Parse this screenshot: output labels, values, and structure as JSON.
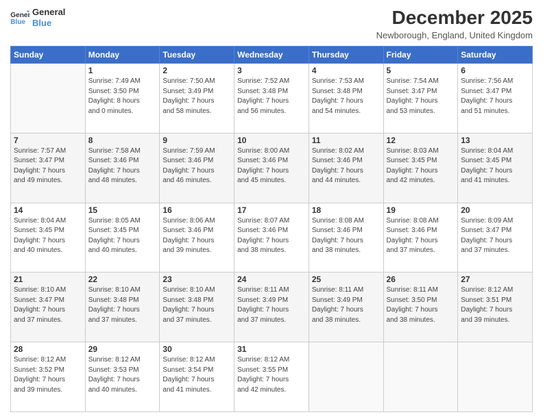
{
  "header": {
    "logo_line1": "General",
    "logo_line2": "Blue",
    "month_year": "December 2025",
    "location": "Newborough, England, United Kingdom"
  },
  "days_of_week": [
    "Sunday",
    "Monday",
    "Tuesday",
    "Wednesday",
    "Thursday",
    "Friday",
    "Saturday"
  ],
  "weeks": [
    [
      {
        "day": "",
        "content": ""
      },
      {
        "day": "1",
        "content": "Sunrise: 7:49 AM\nSunset: 3:50 PM\nDaylight: 8 hours\nand 0 minutes."
      },
      {
        "day": "2",
        "content": "Sunrise: 7:50 AM\nSunset: 3:49 PM\nDaylight: 7 hours\nand 58 minutes."
      },
      {
        "day": "3",
        "content": "Sunrise: 7:52 AM\nSunset: 3:48 PM\nDaylight: 7 hours\nand 56 minutes."
      },
      {
        "day": "4",
        "content": "Sunrise: 7:53 AM\nSunset: 3:48 PM\nDaylight: 7 hours\nand 54 minutes."
      },
      {
        "day": "5",
        "content": "Sunrise: 7:54 AM\nSunset: 3:47 PM\nDaylight: 7 hours\nand 53 minutes."
      },
      {
        "day": "6",
        "content": "Sunrise: 7:56 AM\nSunset: 3:47 PM\nDaylight: 7 hours\nand 51 minutes."
      }
    ],
    [
      {
        "day": "7",
        "content": "Sunrise: 7:57 AM\nSunset: 3:47 PM\nDaylight: 7 hours\nand 49 minutes."
      },
      {
        "day": "8",
        "content": "Sunrise: 7:58 AM\nSunset: 3:46 PM\nDaylight: 7 hours\nand 48 minutes."
      },
      {
        "day": "9",
        "content": "Sunrise: 7:59 AM\nSunset: 3:46 PM\nDaylight: 7 hours\nand 46 minutes."
      },
      {
        "day": "10",
        "content": "Sunrise: 8:00 AM\nSunset: 3:46 PM\nDaylight: 7 hours\nand 45 minutes."
      },
      {
        "day": "11",
        "content": "Sunrise: 8:02 AM\nSunset: 3:46 PM\nDaylight: 7 hours\nand 44 minutes."
      },
      {
        "day": "12",
        "content": "Sunrise: 8:03 AM\nSunset: 3:45 PM\nDaylight: 7 hours\nand 42 minutes."
      },
      {
        "day": "13",
        "content": "Sunrise: 8:04 AM\nSunset: 3:45 PM\nDaylight: 7 hours\nand 41 minutes."
      }
    ],
    [
      {
        "day": "14",
        "content": "Sunrise: 8:04 AM\nSunset: 3:45 PM\nDaylight: 7 hours\nand 40 minutes."
      },
      {
        "day": "15",
        "content": "Sunrise: 8:05 AM\nSunset: 3:45 PM\nDaylight: 7 hours\nand 40 minutes."
      },
      {
        "day": "16",
        "content": "Sunrise: 8:06 AM\nSunset: 3:46 PM\nDaylight: 7 hours\nand 39 minutes."
      },
      {
        "day": "17",
        "content": "Sunrise: 8:07 AM\nSunset: 3:46 PM\nDaylight: 7 hours\nand 38 minutes."
      },
      {
        "day": "18",
        "content": "Sunrise: 8:08 AM\nSunset: 3:46 PM\nDaylight: 7 hours\nand 38 minutes."
      },
      {
        "day": "19",
        "content": "Sunrise: 8:08 AM\nSunset: 3:46 PM\nDaylight: 7 hours\nand 37 minutes."
      },
      {
        "day": "20",
        "content": "Sunrise: 8:09 AM\nSunset: 3:47 PM\nDaylight: 7 hours\nand 37 minutes."
      }
    ],
    [
      {
        "day": "21",
        "content": "Sunrise: 8:10 AM\nSunset: 3:47 PM\nDaylight: 7 hours\nand 37 minutes."
      },
      {
        "day": "22",
        "content": "Sunrise: 8:10 AM\nSunset: 3:48 PM\nDaylight: 7 hours\nand 37 minutes."
      },
      {
        "day": "23",
        "content": "Sunrise: 8:10 AM\nSunset: 3:48 PM\nDaylight: 7 hours\nand 37 minutes."
      },
      {
        "day": "24",
        "content": "Sunrise: 8:11 AM\nSunset: 3:49 PM\nDaylight: 7 hours\nand 37 minutes."
      },
      {
        "day": "25",
        "content": "Sunrise: 8:11 AM\nSunset: 3:49 PM\nDaylight: 7 hours\nand 38 minutes."
      },
      {
        "day": "26",
        "content": "Sunrise: 8:11 AM\nSunset: 3:50 PM\nDaylight: 7 hours\nand 38 minutes."
      },
      {
        "day": "27",
        "content": "Sunrise: 8:12 AM\nSunset: 3:51 PM\nDaylight: 7 hours\nand 39 minutes."
      }
    ],
    [
      {
        "day": "28",
        "content": "Sunrise: 8:12 AM\nSunset: 3:52 PM\nDaylight: 7 hours\nand 39 minutes."
      },
      {
        "day": "29",
        "content": "Sunrise: 8:12 AM\nSunset: 3:53 PM\nDaylight: 7 hours\nand 40 minutes."
      },
      {
        "day": "30",
        "content": "Sunrise: 8:12 AM\nSunset: 3:54 PM\nDaylight: 7 hours\nand 41 minutes."
      },
      {
        "day": "31",
        "content": "Sunrise: 8:12 AM\nSunset: 3:55 PM\nDaylight: 7 hours\nand 42 minutes."
      },
      {
        "day": "",
        "content": ""
      },
      {
        "day": "",
        "content": ""
      },
      {
        "day": "",
        "content": ""
      }
    ]
  ]
}
